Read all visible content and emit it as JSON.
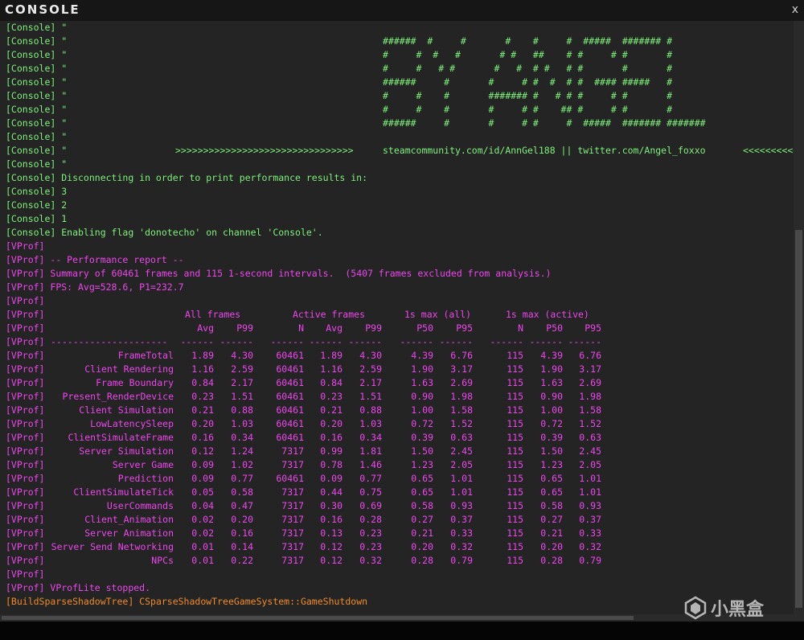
{
  "window": {
    "title": "CONSOLE",
    "close_label": "x"
  },
  "console_banner": [
    {
      "tag": "[Console]",
      "q": "\"",
      "art": ""
    },
    {
      "tag": "[Console]",
      "q": "\"",
      "art": "######  #     #       #    #     #  #####  ####### #"
    },
    {
      "tag": "[Console]",
      "q": "\"",
      "art": "#     #  #   #       # #   ##    # #     # #       #"
    },
    {
      "tag": "[Console]",
      "q": "\"",
      "art": "#     #   # #       #   #  # #   # #       #       #"
    },
    {
      "tag": "[Console]",
      "q": "\"",
      "art": "######     #       #     # #  #  # #  #### #####   #"
    },
    {
      "tag": "[Console]",
      "q": "\"",
      "art": "#     #    #       ####### #   # # #     # #       #"
    },
    {
      "tag": "[Console]",
      "q": "\"",
      "art": "#     #    #       #     # #    ## #     # #       #"
    },
    {
      "tag": "[Console]",
      "q": "\"",
      "art": "######     #       #     # #     #  #####  ####### #######"
    },
    {
      "tag": "[Console]",
      "q": "\"",
      "art": ""
    }
  ],
  "console_link_line": {
    "tag": "[Console]",
    "q": "\"",
    "arrows_left": ">>>>>>>>>>>>>>>>>>>>>>>>>>>>>>>>",
    "links": "steamcommunity.com/id/AnnGel188 || twitter.com/Angel_foxxo",
    "arrows_right": "<<<<<<<<<<<<"
  },
  "console_tail": [
    {
      "tag": "[Console]",
      "text": " \""
    },
    {
      "tag": "[Console]",
      "text": " Disconnecting in order to print performance results in:"
    },
    {
      "tag": "[Console]",
      "text": " 3"
    },
    {
      "tag": "[Console]",
      "text": " 2"
    },
    {
      "tag": "[Console]",
      "text": " 1"
    },
    {
      "tag": "[Console]",
      "text": " Enabling flag 'donotecho' on channel 'Console'."
    }
  ],
  "vprof_intro": [
    {
      "tag": "[VProf]",
      "text": ""
    },
    {
      "tag": "[VProf]",
      "text": " -- Performance report --"
    },
    {
      "tag": "[VProf]",
      "text": " Summary of 60461 frames and 115 1-second intervals.  (5407 frames excluded from analysis.)"
    },
    {
      "tag": "[VProf]",
      "text": " FPS: Avg=528.6, P1=232.7"
    },
    {
      "tag": "[VProf]",
      "text": ""
    }
  ],
  "table": {
    "tag": "[VProf]",
    "groups": [
      "All frames",
      "Active frames",
      "1s max (all)",
      "1s max (active)"
    ],
    "headers": [
      "Avg",
      "P99",
      "N",
      "Avg",
      "P99",
      "P50",
      "P95",
      "N",
      "P50",
      "P95"
    ],
    "separator_name": "---------------------",
    "separator_cell": "------",
    "rows": [
      {
        "name": "FrameTotal",
        "v": [
          "1.89",
          "4.30",
          "60461",
          "1.89",
          "4.30",
          "4.39",
          "6.76",
          "115",
          "4.39",
          "6.76"
        ]
      },
      {
        "name": "Client Rendering",
        "v": [
          "1.16",
          "2.59",
          "60461",
          "1.16",
          "2.59",
          "1.90",
          "3.17",
          "115",
          "1.90",
          "3.17"
        ]
      },
      {
        "name": "Frame Boundary",
        "v": [
          "0.84",
          "2.17",
          "60461",
          "0.84",
          "2.17",
          "1.63",
          "2.69",
          "115",
          "1.63",
          "2.69"
        ]
      },
      {
        "name": "Present_RenderDevice",
        "v": [
          "0.23",
          "1.51",
          "60461",
          "0.23",
          "1.51",
          "0.90",
          "1.98",
          "115",
          "0.90",
          "1.98"
        ]
      },
      {
        "name": "Client Simulation",
        "v": [
          "0.21",
          "0.88",
          "60461",
          "0.21",
          "0.88",
          "1.00",
          "1.58",
          "115",
          "1.00",
          "1.58"
        ]
      },
      {
        "name": "LowLatencySleep",
        "v": [
          "0.20",
          "1.03",
          "60461",
          "0.20",
          "1.03",
          "0.72",
          "1.52",
          "115",
          "0.72",
          "1.52"
        ]
      },
      {
        "name": "ClientSimulateFrame",
        "v": [
          "0.16",
          "0.34",
          "60461",
          "0.16",
          "0.34",
          "0.39",
          "0.63",
          "115",
          "0.39",
          "0.63"
        ]
      },
      {
        "name": "Server Simulation",
        "v": [
          "0.12",
          "1.24",
          "7317",
          "0.99",
          "1.81",
          "1.50",
          "2.45",
          "115",
          "1.50",
          "2.45"
        ]
      },
      {
        "name": "Server Game",
        "v": [
          "0.09",
          "1.02",
          "7317",
          "0.78",
          "1.46",
          "1.23",
          "2.05",
          "115",
          "1.23",
          "2.05"
        ]
      },
      {
        "name": "Prediction",
        "v": [
          "0.09",
          "0.77",
          "60461",
          "0.09",
          "0.77",
          "0.65",
          "1.01",
          "115",
          "0.65",
          "1.01"
        ]
      },
      {
        "name": "ClientSimulateTick",
        "v": [
          "0.05",
          "0.58",
          "7317",
          "0.44",
          "0.75",
          "0.65",
          "1.01",
          "115",
          "0.65",
          "1.01"
        ]
      },
      {
        "name": "UserCommands",
        "v": [
          "0.04",
          "0.47",
          "7317",
          "0.30",
          "0.69",
          "0.58",
          "0.93",
          "115",
          "0.58",
          "0.93"
        ]
      },
      {
        "name": "Client_Animation",
        "v": [
          "0.02",
          "0.20",
          "7317",
          "0.16",
          "0.28",
          "0.27",
          "0.37",
          "115",
          "0.27",
          "0.37"
        ]
      },
      {
        "name": "Server Animation",
        "v": [
          "0.02",
          "0.16",
          "7317",
          "0.13",
          "0.23",
          "0.21",
          "0.33",
          "115",
          "0.21",
          "0.33"
        ]
      },
      {
        "name": "Server Send Networking",
        "v": [
          "0.01",
          "0.14",
          "7317",
          "0.12",
          "0.23",
          "0.20",
          "0.32",
          "115",
          "0.20",
          "0.32"
        ]
      },
      {
        "name": "NPCs",
        "v": [
          "0.01",
          "0.22",
          "7317",
          "0.12",
          "0.32",
          "0.28",
          "0.79",
          "115",
          "0.28",
          "0.79"
        ]
      }
    ]
  },
  "vprof_outro": [
    {
      "tag": "[VProf]",
      "text": ""
    },
    {
      "tag": "[VProf]",
      "text": " VProfLite stopped."
    }
  ],
  "build_line": {
    "tag": "[BuildSparseShadowTree]",
    "text": " CSparseShadowTreeGameSystem::GameShutdown"
  },
  "watermark": {
    "text": "小黑盒",
    "icon": "xiaoheihe-logo-icon"
  },
  "colors": {
    "console": "#7ef07a",
    "vprof": "#ee46ee",
    "build": "#f08a2a",
    "background": "#242424"
  }
}
